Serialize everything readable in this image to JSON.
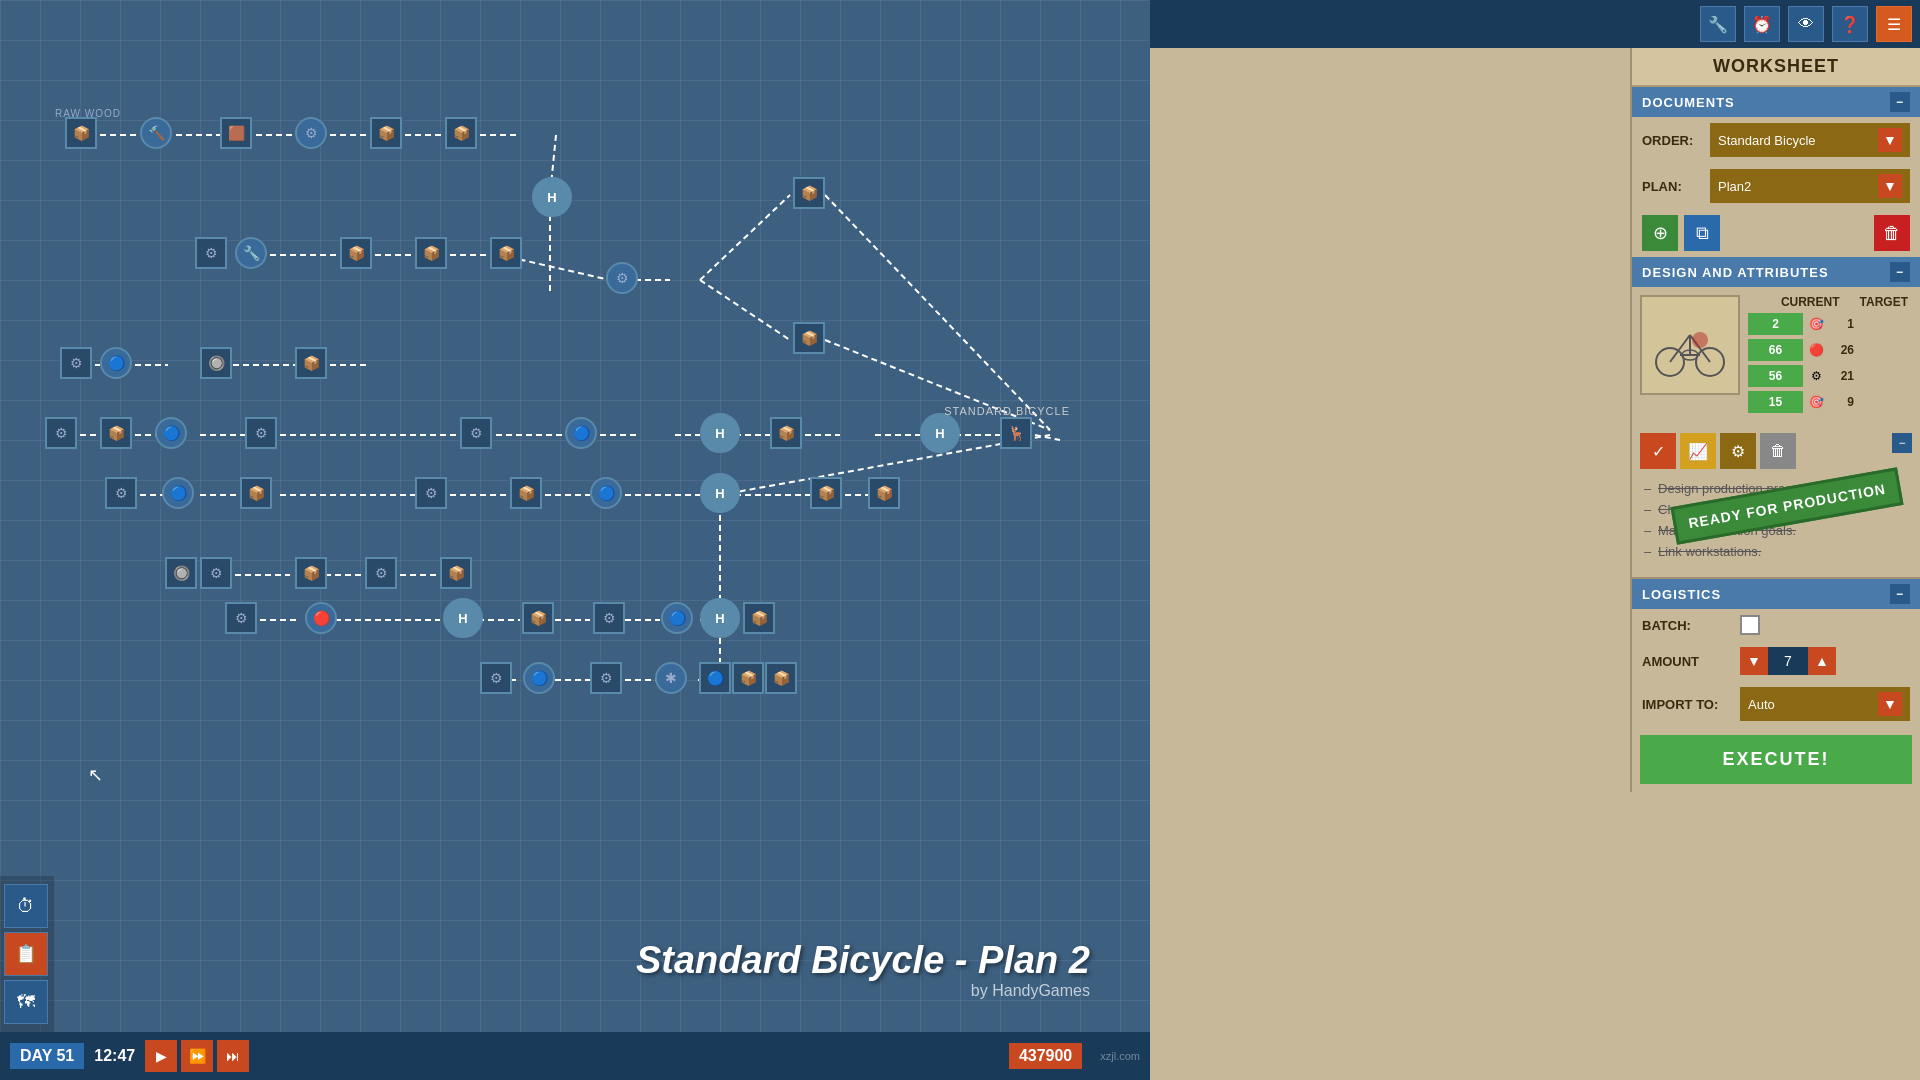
{
  "app": {
    "title": "Standard Bicycle - Plan 2",
    "subtitle": "by HandyGames",
    "raw_wood_label": "RAW WOOD",
    "standard_bicycle_label": "STANDARD BICYCLE"
  },
  "toolbar": {
    "wrench_icon": "🔧",
    "clock_icon": "⏰",
    "eye_icon": "👁",
    "question_icon": "❓",
    "menu_icon": "☰"
  },
  "worksheet": {
    "title": "WORKSHEET",
    "documents_label": "DOCUMENTS",
    "order_label": "ORDER:",
    "order_value": "Standard Bicycle",
    "plan_label": "PLAN:",
    "plan_value": "Plan2"
  },
  "design": {
    "section_label": "DESIGN AND ATTRIBUTES",
    "current_label": "CURRENT",
    "target_label": "TARGET",
    "stats": [
      {
        "current": "2",
        "target": "1"
      },
      {
        "current": "66",
        "target": "26"
      },
      {
        "current": "56",
        "target": "21"
      },
      {
        "current": "15",
        "target": "9"
      }
    ]
  },
  "checklist": {
    "items": [
      "Design production process.",
      "Choose materials.",
      "Match production goals.",
      "Link workstations."
    ],
    "stamp": "READY FOR PRODUCTION"
  },
  "logistics": {
    "section_label": "LOGISTICS",
    "batch_label": "BATCH:",
    "amount_label": "AMOUNT",
    "import_to_label": "IMPORT TO:",
    "import_value": "Auto",
    "amount_value": "7"
  },
  "execute_button": "EXECUTE!",
  "status_bar": {
    "day_label": "DAY 51",
    "time": "12:47",
    "money": "437900"
  },
  "left_sidebar": {
    "clock_icon": "⏱",
    "clipboard_icon": "📋",
    "map_icon": "🗺"
  }
}
